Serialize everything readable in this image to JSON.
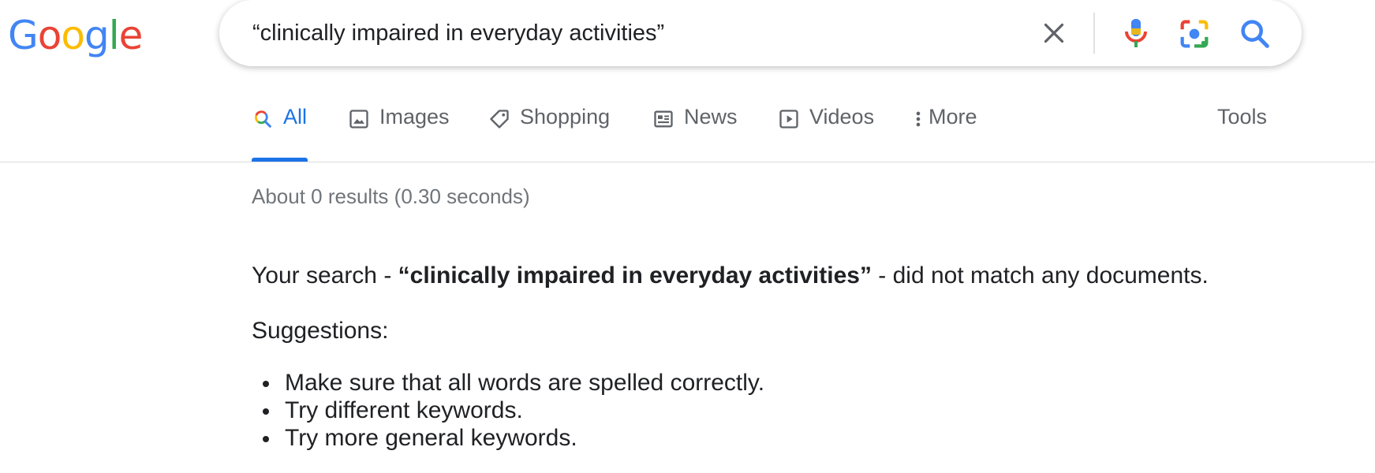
{
  "logo": {
    "letters": [
      "G",
      "o",
      "o",
      "g",
      "l",
      "e"
    ],
    "colors": [
      "#4285F4",
      "#EA4335",
      "#FBBC05",
      "#4285F4",
      "#34A853",
      "#EA4335"
    ]
  },
  "search": {
    "query": "“clinically impaired in everyday activities”"
  },
  "tabs": [
    {
      "label": "All",
      "icon": "search-icon",
      "active": true
    },
    {
      "label": "Images",
      "icon": "image-icon",
      "active": false
    },
    {
      "label": "Shopping",
      "icon": "tag-icon",
      "active": false
    },
    {
      "label": "News",
      "icon": "news-icon",
      "active": false
    },
    {
      "label": "Videos",
      "icon": "play-icon",
      "active": false
    },
    {
      "label": "More",
      "icon": "more-vert-icon",
      "active": false
    }
  ],
  "tools_label": "Tools",
  "results": {
    "stats": "About 0 results (0.30 seconds)",
    "message_prefix": "Your search - ",
    "message_query": "“clinically impaired in everyday activities”",
    "message_suffix": " - did not match any documents.",
    "suggestions_title": "Suggestions:",
    "suggestions": [
      "Make sure that all words are spelled correctly.",
      "Try different keywords.",
      "Try more general keywords."
    ]
  },
  "colors": {
    "accent": "#1a73e8",
    "text": "#202124",
    "muted": "#5f6368",
    "stats": "#70757a"
  }
}
